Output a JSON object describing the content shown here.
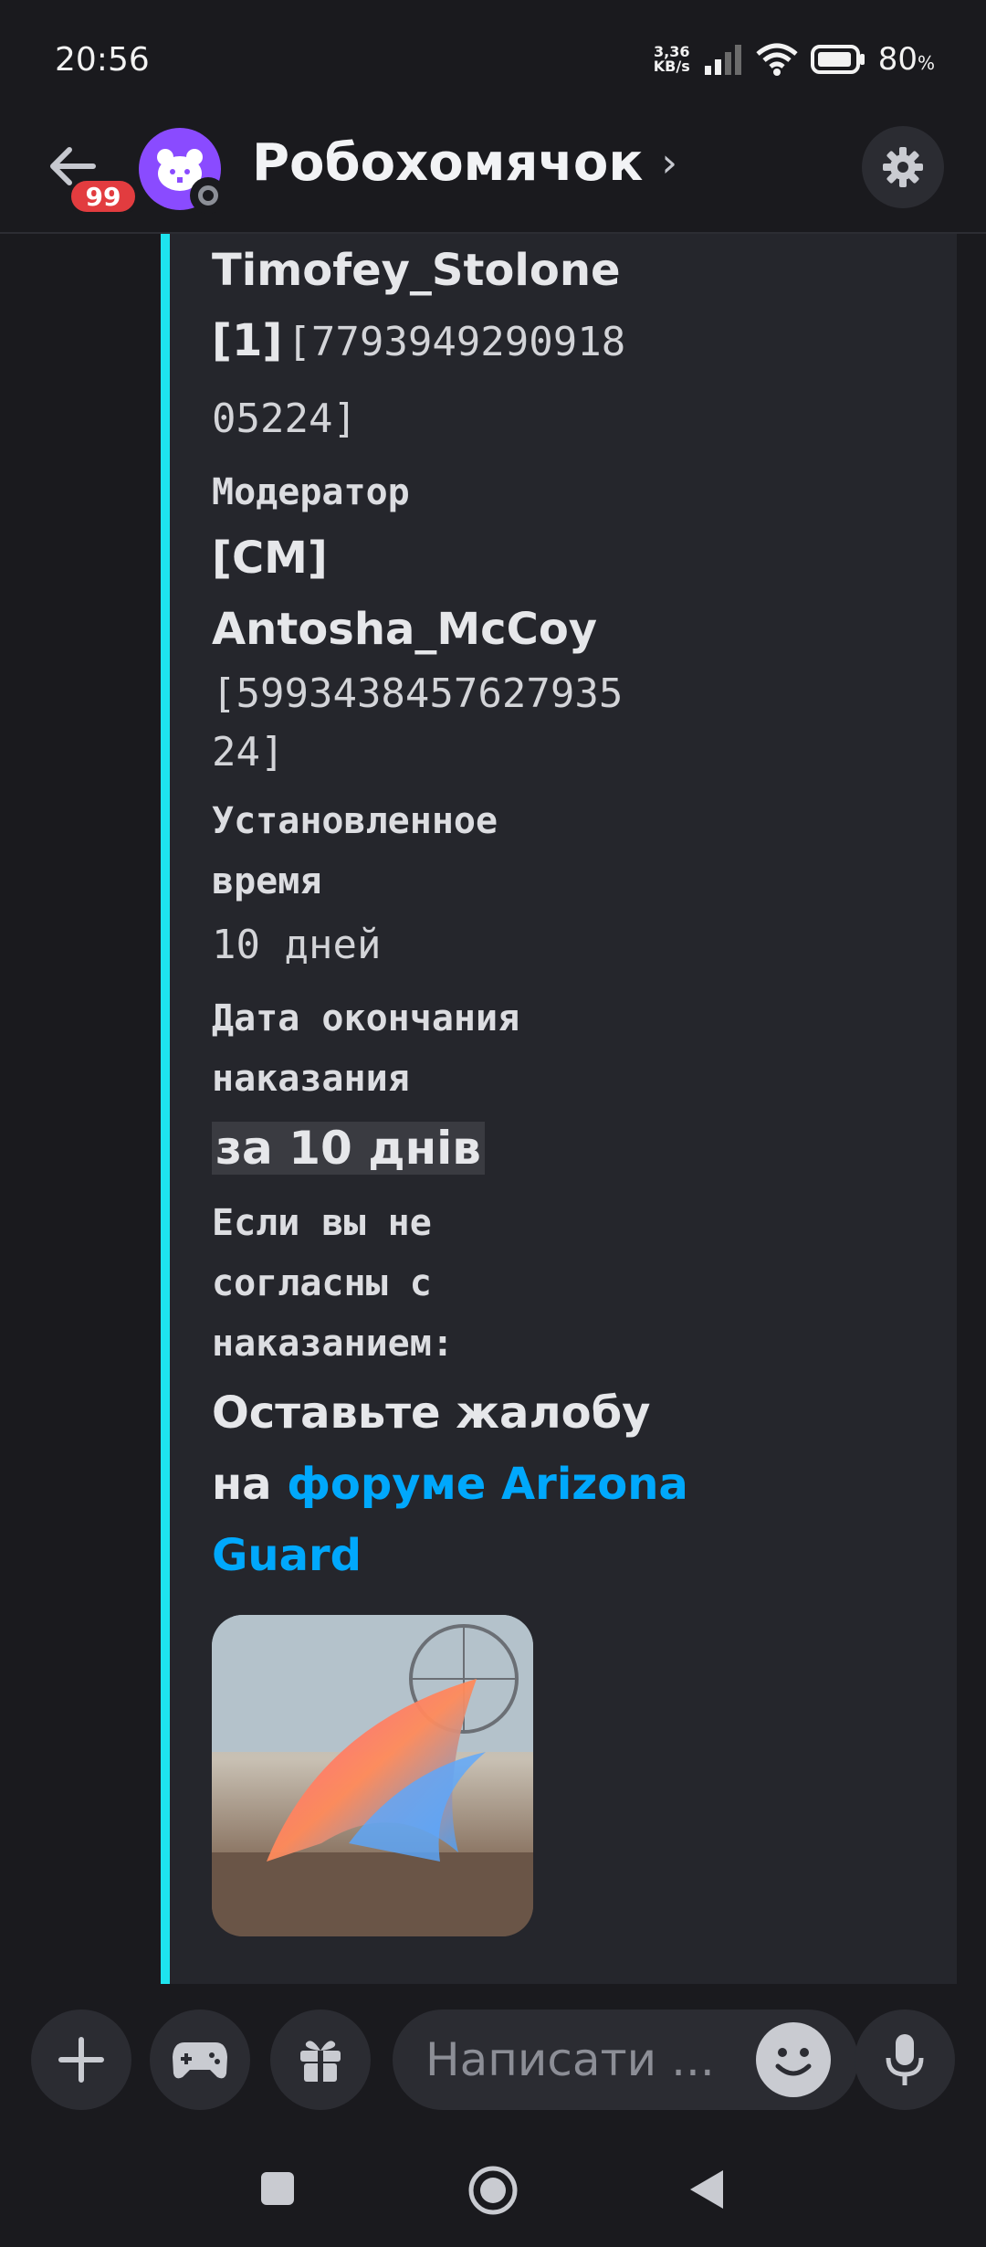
{
  "status_bar": {
    "time": "20:56",
    "net_speed_value": "3,36",
    "net_speed_unit": "KB/s",
    "battery": "80",
    "battery_unit": "%"
  },
  "header": {
    "unread_badge": "99",
    "channel_name": "Робохомячок",
    "chevron": "›"
  },
  "embed": {
    "violator_name": "Timofey_Stolone",
    "violator_tag": "[1]",
    "violator_id_line1": "[7793949290918",
    "violator_id_line2": "05224]",
    "moderator_label": "Модератор",
    "moderator_tag": "[CM]",
    "moderator_name": "Antosha_McCoy",
    "moderator_id_line1": "[5993438457627935",
    "moderator_id_line2": "24]",
    "duration_label_line1": "Установленное",
    "duration_label_line2": "время",
    "duration_value": "10 дней",
    "end_label_line1": "Дата окончания",
    "end_label_line2": "наказания",
    "end_value": "за 10 днів",
    "appeal_label_line1": "Если вы не",
    "appeal_label_line2": "согласны с",
    "appeal_label_line3": "наказанием:",
    "appeal_text_line1": "Оставьте жалобу",
    "appeal_text_prefix": "на ",
    "appeal_link_part1": "форуме Arizona",
    "appeal_link_part2": "Guard",
    "link_color": "#00a8fc",
    "accent_color": "#1ee3ee"
  },
  "input": {
    "placeholder": "Написати ..."
  },
  "icons": {
    "back": "arrow-left-icon",
    "settings": "gear-icon",
    "add": "plus-icon",
    "games": "gamepad-icon",
    "gift": "gift-icon",
    "emoji": "smile-icon",
    "mic": "microphone-icon",
    "nav_recents": "square-icon",
    "nav_home": "circle-icon",
    "nav_back": "triangle-icon"
  }
}
